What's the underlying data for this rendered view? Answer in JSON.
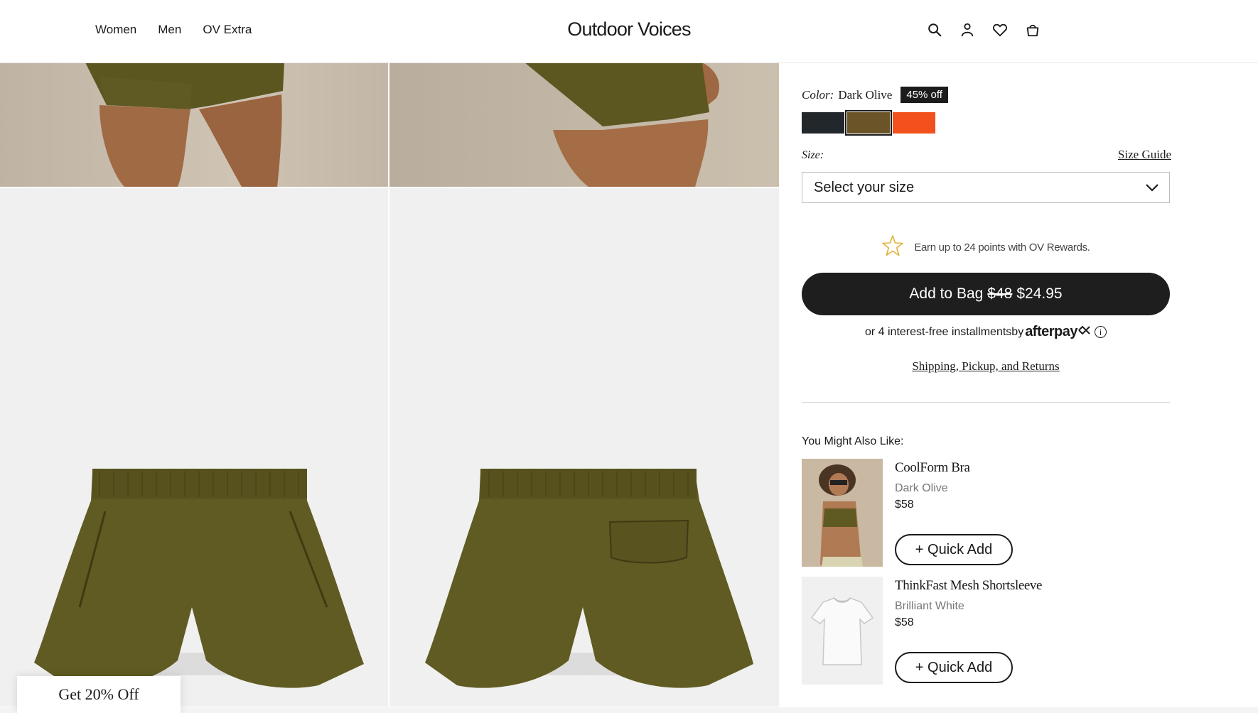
{
  "header": {
    "nav": [
      "Women",
      "Men",
      "OV Extra"
    ],
    "logo": "Outdoor Voices",
    "icons": [
      "search-icon",
      "account-icon",
      "wishlist-heart-icon",
      "shopping-bag-icon"
    ]
  },
  "gallery": {
    "images": [
      "model-shorts-front",
      "model-shorts-side",
      "shorts-flat-front",
      "shorts-flat-back"
    ]
  },
  "product": {
    "color_label": "Color:",
    "color_value": "Dark Olive",
    "discount_badge": "45% off",
    "swatches": [
      {
        "name": "black",
        "hex": "#22272b"
      },
      {
        "name": "dark-olive",
        "hex": "#6a5428",
        "selected": true
      },
      {
        "name": "orange",
        "hex": "#f2501c"
      }
    ],
    "size_label": "Size:",
    "size_guide": "Size Guide",
    "size_placeholder": "Select your size",
    "rewards_text": "Earn up to 24 points with OV Rewards.",
    "add_to_bag": {
      "label": "Add to Bag",
      "original_price": "$48",
      "sale_price": "$24.95"
    },
    "afterpay": {
      "text": "or 4 interest-free installmentsby",
      "brand": "afterpay"
    },
    "shipping_link": "Shipping, Pickup, and Returns"
  },
  "recommendations": {
    "title": "You Might Also Like:",
    "items": [
      {
        "name": "CoolForm Bra",
        "variant": "Dark Olive",
        "price": "$58",
        "button": "+ Quick Add"
      },
      {
        "name": "ThinkFast Mesh Shortsleeve",
        "variant": "Brilliant White",
        "price": "$58",
        "button": "+ Quick Add"
      }
    ]
  },
  "promo": {
    "label": "Get 20% Off"
  },
  "colors": {
    "button_dark": "#1e1e1e",
    "star": "#e0b23a",
    "olive": "#5e5a22"
  }
}
